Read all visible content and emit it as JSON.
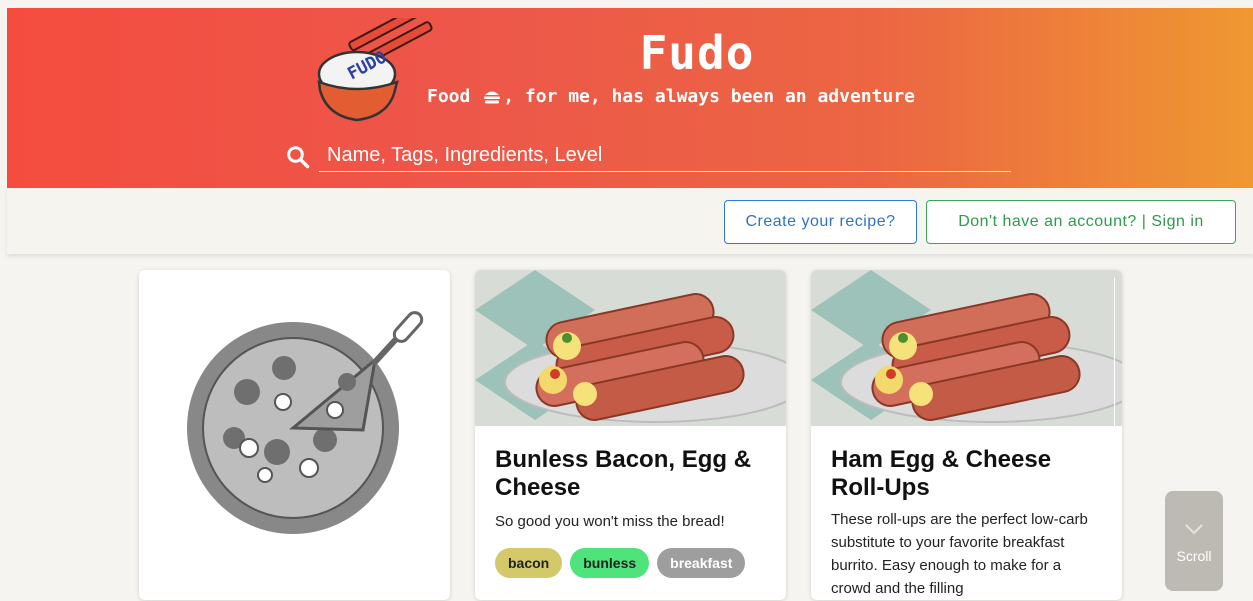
{
  "header": {
    "logo_text": "FUDO",
    "brand": "Fudo",
    "tagline_before": "Food ",
    "tagline_after": ", for me, has always been an adventure",
    "search_placeholder": "Name, Tags, Ingredients, Level"
  },
  "nav": {
    "create_label": "Create your recipe?",
    "signin_label": "Don't have an account? | Sign in"
  },
  "cards": [
    {
      "image": "pizza-placeholder-icon"
    },
    {
      "title": "Bunless Bacon, Egg & Cheese",
      "description": "So good you won't miss the bread!",
      "tags": [
        {
          "label": "bacon",
          "color": "#d4c96a"
        },
        {
          "label": "bunless",
          "color": "#4fe37c"
        },
        {
          "label": "breakfast",
          "color": "#9e9e9e"
        }
      ]
    },
    {
      "title": "Ham Egg & Cheese Roll-Ups",
      "description": "These roll-ups are the perfect low-carb substitute to your favorite breakfast burrito. Easy enough to make for a crowd and the filling"
    }
  ],
  "scroll_label": "Scroll",
  "colors": {
    "header_start": "#f44d3f",
    "header_end": "#ef9831",
    "create_button": "#2f7ad6",
    "signin_button": "#3aa757"
  }
}
